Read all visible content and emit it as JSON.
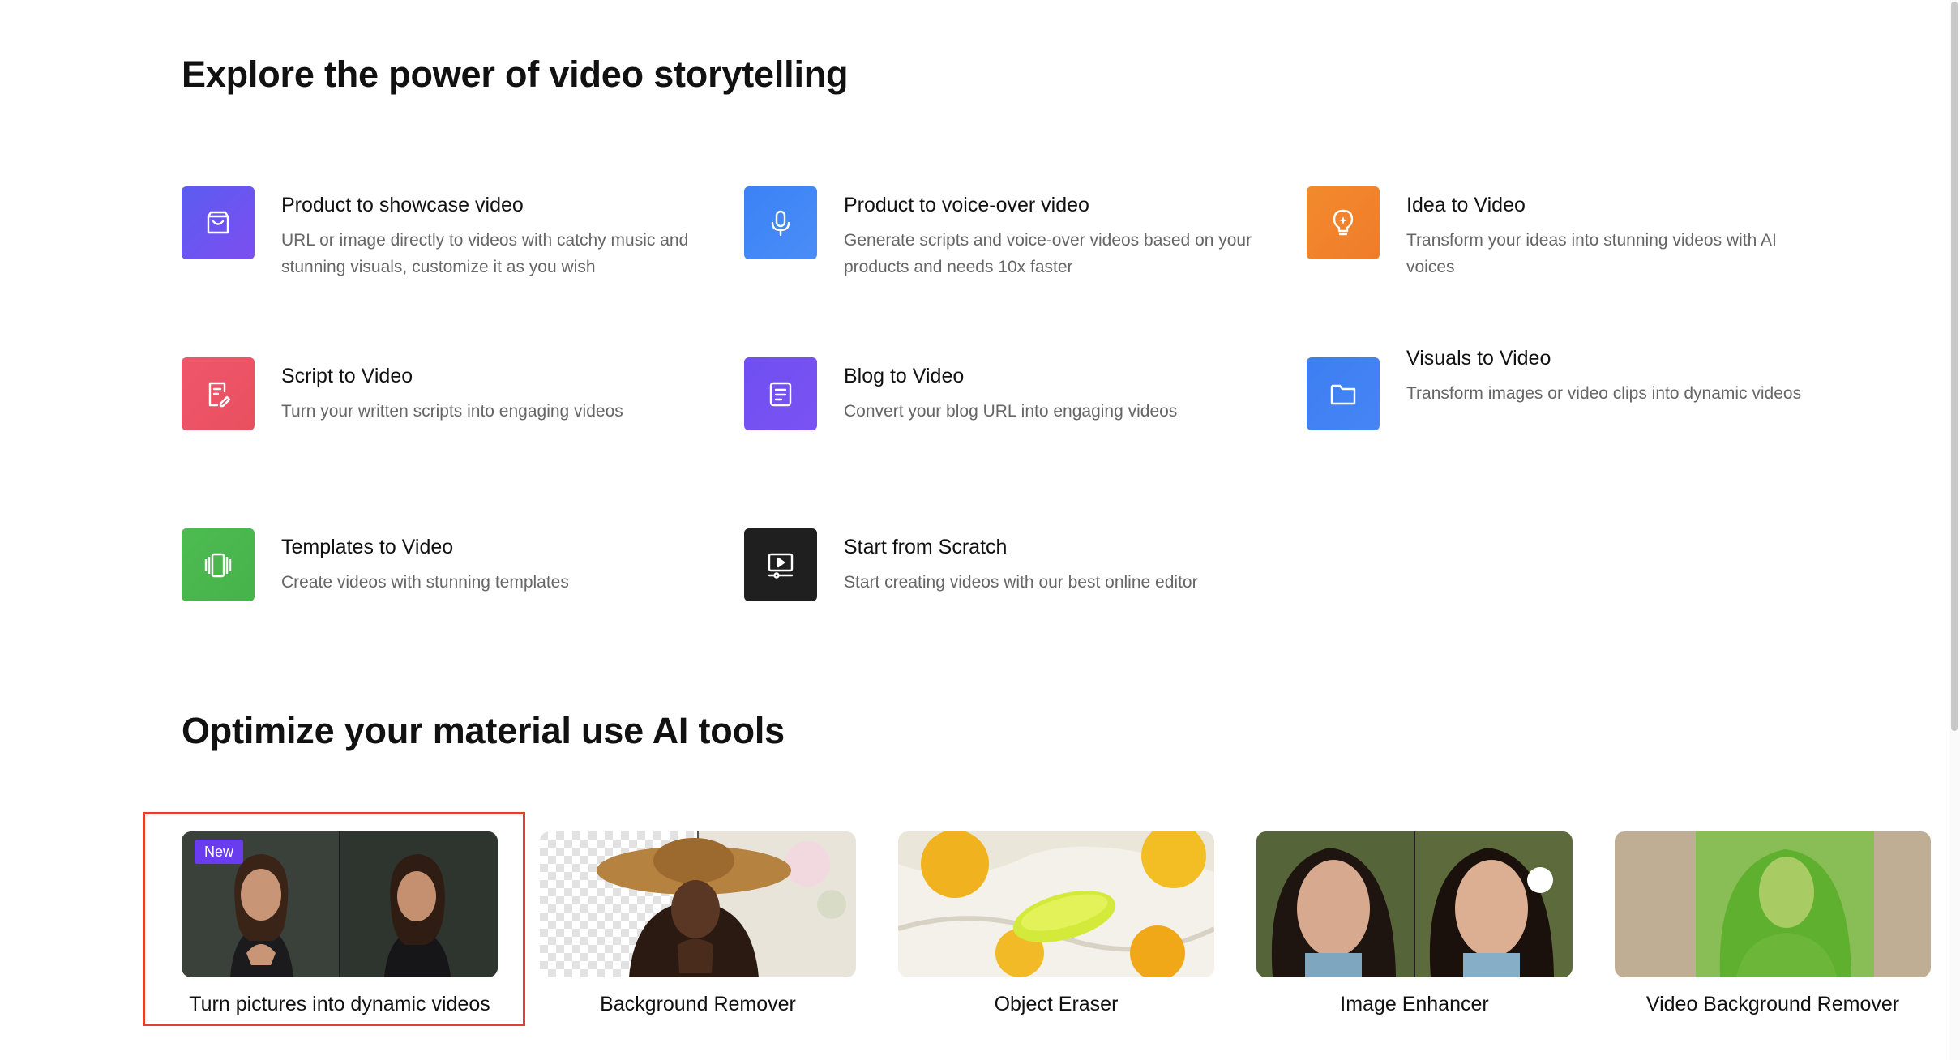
{
  "sections": {
    "explore_title": "Explore the power of video storytelling",
    "optimize_title": "Optimize your material use AI tools"
  },
  "features": [
    {
      "title": "Product to showcase video",
      "desc": "URL or image directly to videos with catchy music and stunning visuals, customize it as you wish",
      "icon": "shopping-bag-icon",
      "color": "#6b4ef0"
    },
    {
      "title": "Product to voice-over video",
      "desc": "Generate scripts and voice-over videos based on your products and needs 10x faster",
      "icon": "microphone-icon",
      "color": "#3b82f6"
    },
    {
      "title": "Idea to Video",
      "desc": "Transform your ideas into stunning videos with AI voices",
      "icon": "lightbulb-icon",
      "color": "#f3862e"
    },
    {
      "title": "Script to Video",
      "desc": "Turn your written scripts into engaging videos",
      "icon": "script-edit-icon",
      "color": "#ec5566"
    },
    {
      "title": "Blog to Video",
      "desc": "Convert your blog URL into engaging videos",
      "icon": "document-lines-icon",
      "color": "#7150f2"
    },
    {
      "title": "Visuals to Video",
      "desc": "Transform images or video clips into dynamic videos",
      "icon": "folder-icon",
      "color": "#3f7ff3"
    },
    {
      "title": "Templates to Video",
      "desc": "Create videos with stunning templates",
      "icon": "templates-icon",
      "color": "#4cb84f"
    },
    {
      "title": "Start from Scratch",
      "desc": "Start creating videos with our best online editor",
      "icon": "video-editor-icon",
      "color": "#1e1e1e"
    }
  ],
  "tools": [
    {
      "label": "Turn pictures into dynamic videos",
      "badge": "New"
    },
    {
      "label": "Background Remover"
    },
    {
      "label": "Object Eraser"
    },
    {
      "label": "Image Enhancer"
    },
    {
      "label": "Video Background Remover"
    }
  ]
}
